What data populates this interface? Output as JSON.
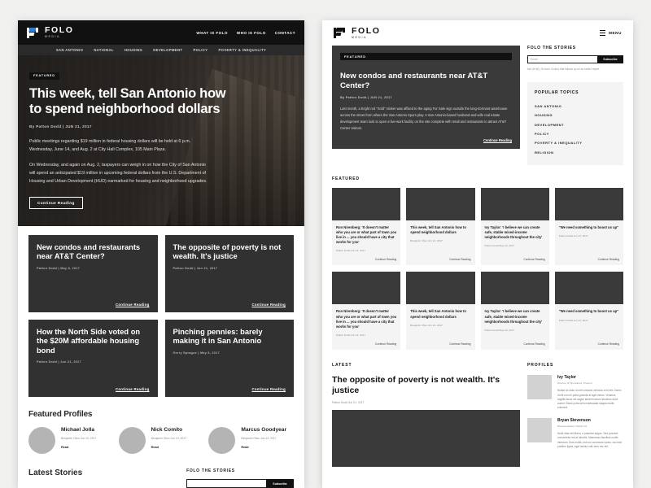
{
  "brand": {
    "name": "FOLO",
    "sub": "MEDIA"
  },
  "left": {
    "topnav": [
      "WHAT IS FOLO",
      "WHO IS FOLO",
      "CONTACT"
    ],
    "sectionnav": [
      "SAN ANTONIO",
      "NATIONAL",
      "HOUSING",
      "DEVELOPMENT",
      "POLICY",
      "POVERTY & INEQUALITY"
    ],
    "hero": {
      "badge": "FEATURED",
      "title": "This week, tell San Antonio how to spend neighborhood dollars",
      "byline": "By Patton Dodd  |  JUN 21, 2017",
      "para1": "Public meetings regarding $19 million in federal housing dollars will be held at 6 p.m. Wednesday, June 14, and Aug. 2 at City Hall Complex, 105 Main Plaza.",
      "para2": "On Wednesday, and again on Aug. 2, taxpayers can weigh in on how the City of San Antonio will spend an anticipated $19 million in upcoming federal dollars from the U.S. Department of Housing and Urban Development (HUD) earmarked for housing and neighborhood upgrades.",
      "cta": "Continue Reading"
    },
    "cards": [
      {
        "title": "New condos and restaurants near AT&T Center?",
        "byline": "Patton Dodd | May 8, 2017",
        "cta": "Continue Reading"
      },
      {
        "title": "The opposite of poverty is not wealth. It's justice",
        "byline": "Patton Dodd | Jun 21, 2017",
        "cta": "Continue Reading"
      },
      {
        "title": "How the North Side voted on the $20M affordable housing bond",
        "byline": "Patton Dodd | Jun 21, 2017",
        "cta": "Continue Reading"
      },
      {
        "title": "Pinching pennies: barely making it in San Antonio",
        "byline": "Gerry Sprague | May 8, 2017",
        "cta": "Continue Reading"
      }
    ],
    "profiles_heading": "Featured Profiles",
    "profiles": [
      {
        "name": "Michael Jolla",
        "meta": "Benjamin Olivo\nJun 13, 2017",
        "read": "Read"
      },
      {
        "name": "Nick Comito",
        "meta": "Benjamin Olivo\nJun 13, 2017",
        "read": "Read"
      },
      {
        "name": "Marcus Goodyear",
        "meta": "Benjamin Olivo\nJun 13, 2017",
        "read": "Read"
      }
    ],
    "latest_heading": "Latest Stories",
    "folo_heading": "FOLO THE STORIES",
    "subscribe_label": "Subscribe"
  },
  "right": {
    "menu_label": "MENU",
    "hero": {
      "badge": "FEATURED",
      "title": "New condos and restaurants near AT&T Center?",
      "byline": "By Patton Dodd  |  JUN 21, 2017",
      "body": "Last month, a bright red \"Sold\" sticker was affixed to the aging For Sale sign outside the long-dormant warehouse across the street from where the San Antonio Spurs play. A San Antonio-based husband-and-wife real estate development team look to open a live-work facility on the site complete with retail and restaurants to attract AT&T Center visitors.",
      "cta": "Continue Reading"
    },
    "sidebar": {
      "folo_heading": "FOLO THE STORIES",
      "email_placeholder": "Email",
      "subscribe_label": "Subscribe",
      "note": "folo (fō·lō) | fō·noun. A story that follows up on an earlier report.",
      "topics_heading": "POPULAR TOPICS",
      "topics": [
        "SAN ANTONIO",
        "HOUSING",
        "DEVELOPMENT",
        "POLICY",
        "POVERTY & INEQUALITY",
        "RELIGION"
      ]
    },
    "featured_heading": "FEATURED",
    "featured_cards": [
      {
        "title": "Ron Nirenberg: 'It doesn't matter who you are or what part of town you live in ... you should have a city that works for you'",
        "byline": "Patton Dodd   Jun 21, 2017",
        "cta": "Continue Reading"
      },
      {
        "title": "This week, tell San Antonio how to spend neighborhood dollars",
        "byline": "Benjamin Olivo   Jun 21, 2017",
        "cta": "Continue Reading"
      },
      {
        "title": "Ivy Taylor: 'I believe we can create safe, stable mixed-income neighborhoods throughout the city'",
        "byline": "Patton Dodd   May 24, 2017",
        "cta": "Continue Reading"
      },
      {
        "title": "\"We need something to boost us up\"",
        "byline": "Patton Dodd   Jun 21, 2017",
        "cta": "Continue Reading"
      }
    ],
    "latest_heading": "LATEST",
    "latest_title": "The opposite of poverty is not wealth. It's justice",
    "latest_byline": "Patton Dodd   Jun 21, 2017",
    "profiles_heading": "PROFILES",
    "profiles": [
      {
        "name": "Ivy Taylor",
        "role": "Director of Operations, Present",
        "body": "Nullam id dolor id nibh ultricies vehicula ut id elit. Donec id elit non mi porta gravida at eget metus. Vivamus sagittis lacus vel augue laoreet rutrum faucibus dolor auctor. Etiam porta sem malesuada magna mollis euismod."
      },
      {
        "name": "Bryan Stevenson",
        "role": "Representative, District 10",
        "body": "Nulla vitae elit libero, a pharetra augue. Sed posuere consectetur est at lobortis. Maecenas faucibus mollis interdum. Duis mollis, est non commodo luctus, nisi erat porttitor ligula, eget lacinia odio sem nec elit."
      }
    ]
  }
}
